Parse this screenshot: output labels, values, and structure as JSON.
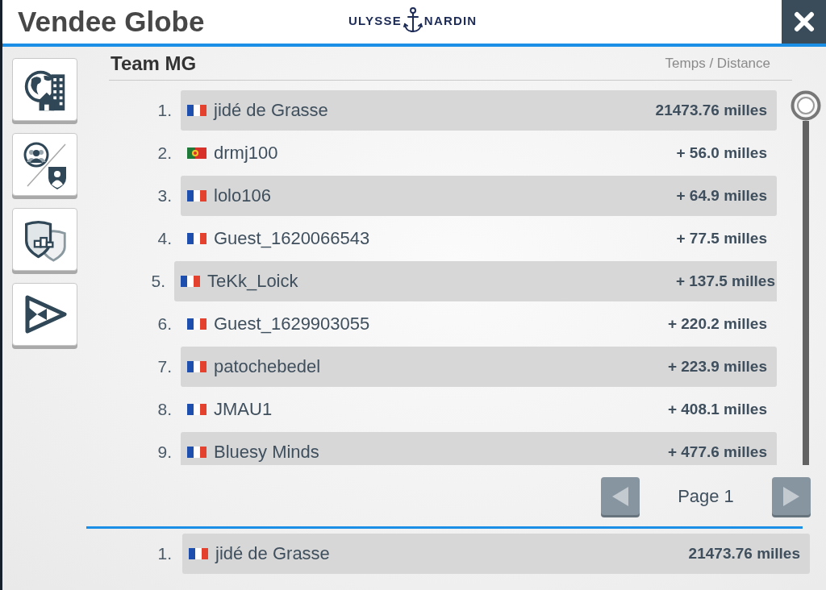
{
  "header": {
    "title": "Vendee Globe",
    "logo": {
      "left": "ULYSSE",
      "right": "NARDIN"
    }
  },
  "panel": {
    "title": "Team MG",
    "column_label": "Temps / Distance"
  },
  "rows": [
    {
      "rank": "1.",
      "flag": {
        "kind": "france"
      },
      "name": "jidé de Grasse",
      "distance": "21473.76 milles",
      "selected": false
    },
    {
      "rank": "2.",
      "flag": {
        "kind": "portugal"
      },
      "name": "drmj100",
      "distance": "+ 56.0 milles",
      "selected": false
    },
    {
      "rank": "3.",
      "flag": {
        "kind": "france"
      },
      "name": "lolo106",
      "distance": "+ 64.9 milles",
      "selected": false
    },
    {
      "rank": "4.",
      "flag": {
        "kind": "france"
      },
      "name": "Guest_1620066543",
      "distance": "+ 77.5 milles",
      "selected": false
    },
    {
      "rank": "5.",
      "flag": {
        "kind": "france"
      },
      "name": "TeKk_Loick",
      "distance": "+ 137.5 milles",
      "selected": true
    },
    {
      "rank": "6.",
      "flag": {
        "kind": "france"
      },
      "name": "Guest_1629903055",
      "distance": "+ 220.2 milles",
      "selected": false
    },
    {
      "rank": "7.",
      "flag": {
        "kind": "france"
      },
      "name": "patochebedel",
      "distance": "+ 223.9 milles",
      "selected": false
    },
    {
      "rank": "8.",
      "flag": {
        "kind": "france"
      },
      "name": "JMAU1",
      "distance": "+ 408.1 milles",
      "selected": false
    },
    {
      "rank": "9.",
      "flag": {
        "kind": "france"
      },
      "name": "Bluesy Minds",
      "distance": "+ 477.6 milles",
      "selected": false
    }
  ],
  "pagination": {
    "label": "Page 1"
  },
  "own_entry": {
    "rank": "1.",
    "flag": {
      "kind": "france"
    },
    "name": "jidé de Grasse",
    "distance": "21473.76 milles"
  }
}
